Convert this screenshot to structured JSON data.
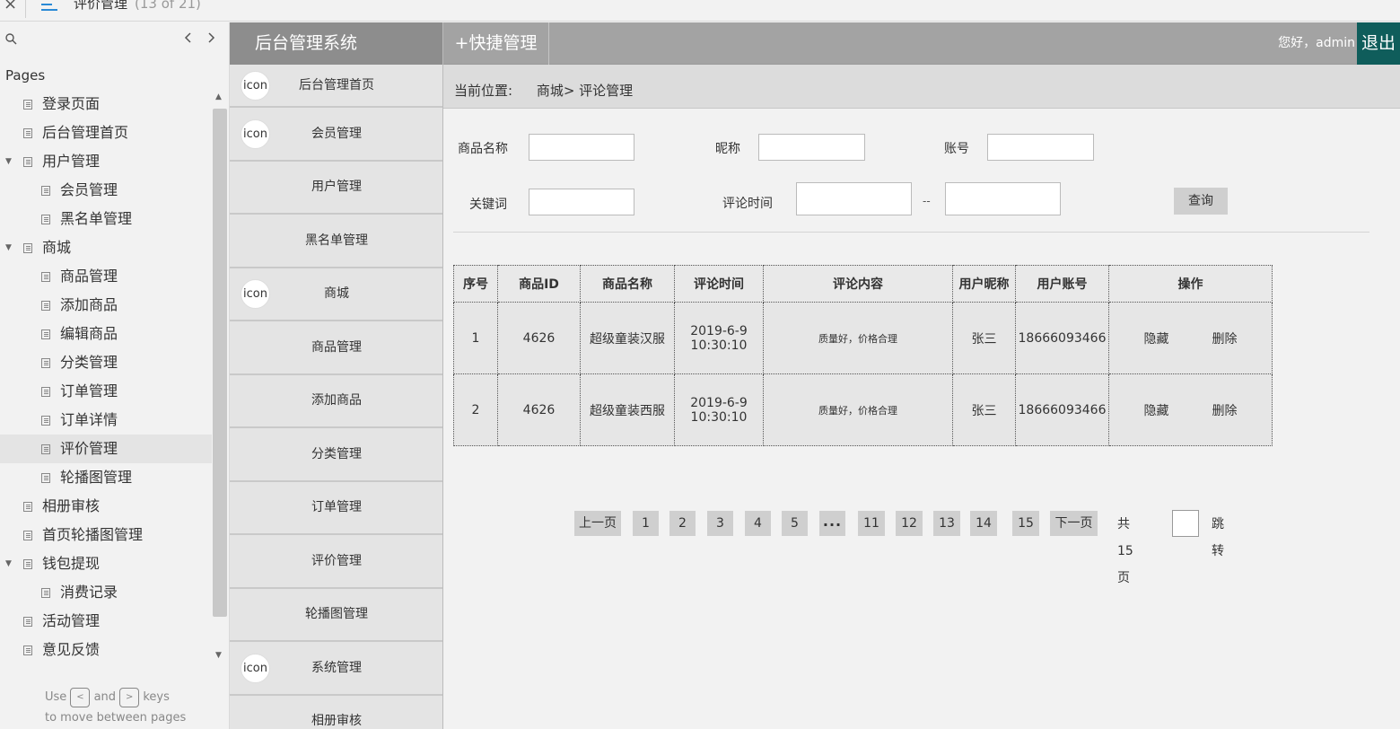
{
  "axure": {
    "close_glyph": "×",
    "page_title": "评价管理",
    "page_count": "(13 of 21)",
    "pages_heading": "Pages",
    "pages": [
      {
        "label": "登录页面",
        "level": 1
      },
      {
        "label": "后台管理首页",
        "level": 1
      },
      {
        "label": "用户管理",
        "level": 1,
        "expanded": true
      },
      {
        "label": "会员管理",
        "level": 2
      },
      {
        "label": "黑名单管理",
        "level": 2
      },
      {
        "label": "商城",
        "level": 1,
        "expanded": true
      },
      {
        "label": "商品管理",
        "level": 2
      },
      {
        "label": "添加商品",
        "level": 2
      },
      {
        "label": "编辑商品",
        "level": 2
      },
      {
        "label": "分类管理",
        "level": 2
      },
      {
        "label": "订单管理",
        "level": 2
      },
      {
        "label": "订单详情",
        "level": 2
      },
      {
        "label": "评价管理",
        "level": 2,
        "active": true
      },
      {
        "label": "轮播图管理",
        "level": 2
      },
      {
        "label": "相册审核",
        "level": 1
      },
      {
        "label": "首页轮播图管理",
        "level": 1
      },
      {
        "label": "钱包提现",
        "level": 1,
        "expanded": true
      },
      {
        "label": "消费记录",
        "level": 2
      },
      {
        "label": "活动管理",
        "level": 1
      },
      {
        "label": "意见反馈",
        "level": 1
      }
    ],
    "hint": {
      "use": "Use",
      "key_prev": "<",
      "and": "and",
      "key_next": ">",
      "keys": "keys",
      "line2": "to move between pages"
    }
  },
  "app": {
    "brand": "后台管理系统",
    "quick": "+快捷管理",
    "greeting": "您好，admin",
    "logout": "退出",
    "menu": [
      {
        "label": "后台管理首页",
        "icon": "icon"
      },
      {
        "label": "会员管理",
        "icon": "icon"
      },
      {
        "label": "用户管理",
        "icon": ""
      },
      {
        "label": "黑名单管理",
        "icon": ""
      },
      {
        "label": "商城",
        "icon": "icon"
      },
      {
        "label": "商品管理",
        "icon": ""
      },
      {
        "label": "添加商品",
        "icon": ""
      },
      {
        "label": "分类管理",
        "icon": ""
      },
      {
        "label": "订单管理",
        "icon": ""
      },
      {
        "label": "评价管理",
        "icon": ""
      },
      {
        "label": "轮播图管理",
        "icon": ""
      },
      {
        "label": "系统管理",
        "icon": "icon"
      },
      {
        "label": "相册审核",
        "icon": ""
      }
    ]
  },
  "breadcrumb": {
    "where": "当前位置:",
    "path": "商城> 评论管理"
  },
  "filters": {
    "product_name": {
      "label": "商品名称",
      "value": ""
    },
    "nickname": {
      "label": "昵称",
      "value": ""
    },
    "account": {
      "label": "账号",
      "value": ""
    },
    "keyword": {
      "label": "关键词",
      "value": ""
    },
    "comment_time": {
      "label": "评论时间",
      "from": "",
      "to": "",
      "separator": "--"
    },
    "query_button": "查询"
  },
  "table": {
    "headers": [
      "序号",
      "商品ID",
      "商品名称",
      "评论时间",
      "评论内容",
      "用户昵称",
      "用户账号",
      "操作"
    ],
    "rows": [
      {
        "no": "1",
        "product_id": "4626",
        "product_name": "超级童装汉服",
        "time_date": "2019-6-9",
        "time_clock": "10:30:10",
        "content": "质量好，价格合理",
        "nickname": "张三",
        "account": "18666093466",
        "hide": "隐藏",
        "delete": "删除"
      },
      {
        "no": "2",
        "product_id": "4626",
        "product_name": "超级童装西服",
        "time_date": "2019-6-9",
        "time_clock": "10:30:10",
        "content": "质量好，价格合理",
        "nickname": "张三",
        "account": "18666093466",
        "hide": "隐藏",
        "delete": "删除"
      }
    ]
  },
  "pagination": {
    "prev": "上一页",
    "pages": [
      "1",
      "2",
      "3",
      "4",
      "5",
      "...",
      "11",
      "12",
      "13",
      "14",
      "15"
    ],
    "next": "下一页",
    "total": "共15页",
    "jump_value": "",
    "jump": "跳转"
  },
  "colors": {
    "logout_bg": "#0f5d5b",
    "header_bg": "#a3a3a3",
    "brand_bg": "#8d8d8d"
  }
}
